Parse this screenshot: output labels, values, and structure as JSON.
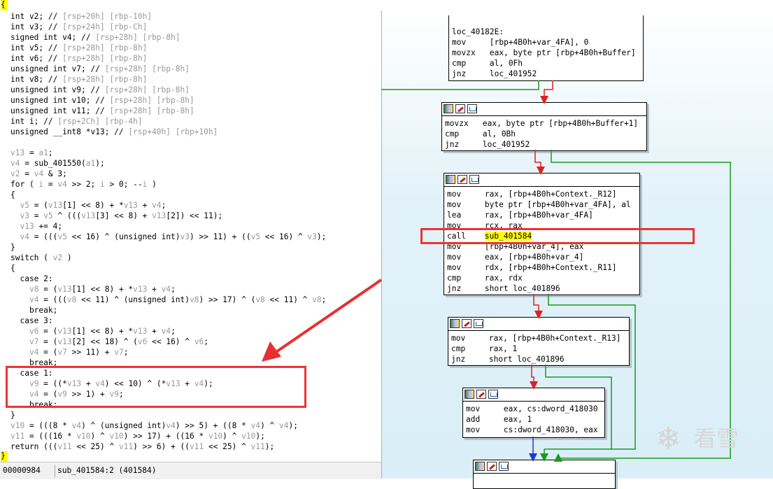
{
  "code": {
    "top_brace": "{",
    "bottom_brace": "}",
    "lines": [
      [
        [
          "int v2; // ",
          ""
        ],
        [
          "[rsp+20h] [rbp-10h]",
          "cm"
        ]
      ],
      [
        [
          "int v3; // ",
          ""
        ],
        [
          "[rsp+24h] [rbp-Ch]",
          "cm"
        ]
      ],
      [
        [
          "signed int v4; // ",
          ""
        ],
        [
          "[rsp+28h] [rbp-8h]",
          "cm"
        ]
      ],
      [
        [
          "int v5; // ",
          ""
        ],
        [
          "[rsp+28h] [rbp-8h]",
          "cm"
        ]
      ],
      [
        [
          "int v6; // ",
          ""
        ],
        [
          "[rsp+28h] [rbp-8h]",
          "cm"
        ]
      ],
      [
        [
          "unsigned int v7; // ",
          ""
        ],
        [
          "[rsp+28h] [rbp-8h]",
          "cm"
        ]
      ],
      [
        [
          "int v8; // ",
          ""
        ],
        [
          "[rsp+28h] [rbp-8h]",
          "cm"
        ]
      ],
      [
        [
          "unsigned int v9; // ",
          ""
        ],
        [
          "[rsp+28h] [rbp-8h]",
          "cm"
        ]
      ],
      [
        [
          "unsigned int v10; // ",
          ""
        ],
        [
          "[rsp+28h] [rbp-8h]",
          "cm"
        ]
      ],
      [
        [
          "unsigned int v11; // ",
          ""
        ],
        [
          "[rsp+28h] [rbp-8h]",
          "cm"
        ]
      ],
      [
        [
          "int i; // ",
          ""
        ],
        [
          "[rsp+2Ch] [rbp-4h]",
          "cm"
        ]
      ],
      [
        [
          "unsigned __int8 *v13; // ",
          ""
        ],
        [
          "[rsp+40h] [rbp+10h]",
          "cm"
        ]
      ],
      [
        [
          "",
          ""
        ]
      ],
      [
        [
          "v13",
          "cm"
        ],
        [
          " = ",
          ""
        ],
        [
          "a1",
          "cm"
        ],
        [
          ";",
          ""
        ]
      ],
      [
        [
          "v4",
          "cm"
        ],
        [
          " = sub_401550(",
          ""
        ],
        [
          "a1",
          "cm"
        ],
        [
          ");",
          ""
        ]
      ],
      [
        [
          "v2",
          "cm"
        ],
        [
          " = ",
          ""
        ],
        [
          "v4",
          "cm"
        ],
        [
          " & 3;",
          ""
        ]
      ],
      [
        [
          "for ( ",
          ""
        ],
        [
          "i",
          "cm"
        ],
        [
          " = ",
          ""
        ],
        [
          "v4",
          "cm"
        ],
        [
          " >> 2; ",
          ""
        ],
        [
          "i",
          "cm"
        ],
        [
          " > 0; --",
          ""
        ],
        [
          "i",
          "cm"
        ],
        [
          " )",
          ""
        ]
      ],
      [
        [
          "{",
          ""
        ]
      ],
      [
        [
          "  ",
          ""
        ],
        [
          "v5",
          "cm"
        ],
        [
          " = (",
          ""
        ],
        [
          "v13",
          "cm"
        ],
        [
          "[1] << 8) + *",
          ""
        ],
        [
          "v13",
          "cm"
        ],
        [
          " + ",
          ""
        ],
        [
          "v4",
          "cm"
        ],
        [
          ";",
          ""
        ]
      ],
      [
        [
          "  ",
          ""
        ],
        [
          "v3",
          "cm"
        ],
        [
          " = ",
          ""
        ],
        [
          "v5",
          "cm"
        ],
        [
          " ^ (((",
          ""
        ],
        [
          "v13",
          "cm"
        ],
        [
          "[3] << 8) + ",
          ""
        ],
        [
          "v13",
          "cm"
        ],
        [
          "[2]) << 11);",
          ""
        ]
      ],
      [
        [
          "  ",
          ""
        ],
        [
          "v13",
          "cm"
        ],
        [
          " += 4;",
          ""
        ]
      ],
      [
        [
          "  ",
          ""
        ],
        [
          "v4",
          "cm"
        ],
        [
          " = (((",
          ""
        ],
        [
          "v5",
          "cm"
        ],
        [
          " << 16) ^ (unsigned int)",
          ""
        ],
        [
          "v3",
          "cm"
        ],
        [
          ") >> 11) + ((",
          ""
        ],
        [
          "v5",
          "cm"
        ],
        [
          " << 16) ^ ",
          ""
        ],
        [
          "v3",
          "cm"
        ],
        [
          ");",
          ""
        ]
      ],
      [
        [
          "}",
          ""
        ]
      ],
      [
        [
          "switch ( ",
          ""
        ],
        [
          "v2",
          "cm"
        ],
        [
          " )",
          ""
        ]
      ],
      [
        [
          "{",
          ""
        ]
      ],
      [
        [
          "  case 2:",
          ""
        ]
      ],
      [
        [
          "    ",
          ""
        ],
        [
          "v8",
          "cm"
        ],
        [
          " = (",
          ""
        ],
        [
          "v13",
          "cm"
        ],
        [
          "[1] << 8) + *",
          ""
        ],
        [
          "v13",
          "cm"
        ],
        [
          " + ",
          ""
        ],
        [
          "v4",
          "cm"
        ],
        [
          ";",
          ""
        ]
      ],
      [
        [
          "    ",
          ""
        ],
        [
          "v4",
          "cm"
        ],
        [
          " = (((",
          ""
        ],
        [
          "v8",
          "cm"
        ],
        [
          " << 11) ^ (unsigned int)",
          ""
        ],
        [
          "v8",
          "cm"
        ],
        [
          ") >> 17) ^ (",
          ""
        ],
        [
          "v8",
          "cm"
        ],
        [
          " << 11) ^ ",
          ""
        ],
        [
          "v8",
          "cm"
        ],
        [
          ";",
          ""
        ]
      ],
      [
        [
          "    break;",
          ""
        ]
      ],
      [
        [
          "  case 3:",
          ""
        ]
      ],
      [
        [
          "    ",
          ""
        ],
        [
          "v6",
          "cm"
        ],
        [
          " = (",
          ""
        ],
        [
          "v13",
          "cm"
        ],
        [
          "[1] << 8) + *",
          ""
        ],
        [
          "v13",
          "cm"
        ],
        [
          " + ",
          ""
        ],
        [
          "v4",
          "cm"
        ],
        [
          ";",
          ""
        ]
      ],
      [
        [
          "    ",
          ""
        ],
        [
          "v7",
          "cm"
        ],
        [
          " = (",
          ""
        ],
        [
          "v13",
          "cm"
        ],
        [
          "[2] << 18) ^ (",
          ""
        ],
        [
          "v6",
          "cm"
        ],
        [
          " << 16) ^ ",
          ""
        ],
        [
          "v6",
          "cm"
        ],
        [
          ";",
          ""
        ]
      ],
      [
        [
          "    ",
          ""
        ],
        [
          "v4",
          "cm"
        ],
        [
          " = (",
          ""
        ],
        [
          "v7",
          "cm"
        ],
        [
          " >> 11) + ",
          ""
        ],
        [
          "v7",
          "cm"
        ],
        [
          ";",
          ""
        ]
      ],
      [
        [
          "    break;",
          ""
        ]
      ],
      [
        [
          "  case 1:",
          ""
        ]
      ],
      [
        [
          "    ",
          ""
        ],
        [
          "v9",
          "cm"
        ],
        [
          " = ((*",
          ""
        ],
        [
          "v13",
          "cm"
        ],
        [
          " + ",
          ""
        ],
        [
          "v4",
          "cm"
        ],
        [
          ") << 10) ^ (*",
          ""
        ],
        [
          "v13",
          "cm"
        ],
        [
          " + ",
          ""
        ],
        [
          "v4",
          "cm"
        ],
        [
          ");",
          ""
        ]
      ],
      [
        [
          "    ",
          ""
        ],
        [
          "v4",
          "cm"
        ],
        [
          " = (",
          ""
        ],
        [
          "v9",
          "cm"
        ],
        [
          " >> 1) + ",
          ""
        ],
        [
          "v9",
          "cm"
        ],
        [
          ";",
          ""
        ]
      ],
      [
        [
          "    break;",
          ""
        ]
      ],
      [
        [
          "}",
          ""
        ]
      ],
      [
        [
          "v10",
          "cm"
        ],
        [
          " = (((8 * ",
          ""
        ],
        [
          "v4",
          "cm"
        ],
        [
          ") ^ (unsigned int)",
          ""
        ],
        [
          "v4",
          "cm"
        ],
        [
          ") >> 5) + ((8 * ",
          ""
        ],
        [
          "v4",
          "cm"
        ],
        [
          ") ^ ",
          ""
        ],
        [
          "v4",
          "cm"
        ],
        [
          ");",
          ""
        ]
      ],
      [
        [
          "v11",
          "cm"
        ],
        [
          " = (((16 * ",
          ""
        ],
        [
          "v10",
          "cm"
        ],
        [
          ") ^ ",
          ""
        ],
        [
          "v10",
          "cm"
        ],
        [
          ") >> 17) + ((16 * ",
          ""
        ],
        [
          "v10",
          "cm"
        ],
        [
          ") ^ ",
          ""
        ],
        [
          "v10",
          "cm"
        ],
        [
          ");",
          ""
        ]
      ],
      [
        [
          "return (((",
          ""
        ],
        [
          "v11",
          "cm"
        ],
        [
          " << 25) ^ ",
          ""
        ],
        [
          "v11",
          "cm"
        ],
        [
          ") >> 6) + ((",
          ""
        ],
        [
          "v11",
          "cm"
        ],
        [
          " << 25) ^ ",
          ""
        ],
        [
          "v11",
          "cm"
        ],
        [
          ");",
          ""
        ]
      ]
    ]
  },
  "status": {
    "offset": "00000984",
    "location": "sub_401584:2 (401584)"
  },
  "graph": {
    "blocks": [
      {
        "lines": [
          [
            "loc_40182E:",
            ""
          ],
          [
            "mov     [rbp+4B0h+var_4FA], 0",
            ""
          ],
          [
            "movzx   eax, byte ptr [rbp+4B0h+Buffer]",
            ""
          ],
          [
            "cmp     al, 0Fh",
            ""
          ],
          [
            "jnz     loc_401952",
            ""
          ]
        ]
      },
      {
        "lines": [
          [
            "movzx   eax, byte ptr [rbp+4B0h+Buffer+1]",
            ""
          ],
          [
            "cmp     al, 0Bh",
            ""
          ],
          [
            "jnz     loc_401952",
            ""
          ]
        ]
      },
      {
        "lines": [
          [
            "mov     rax, [rbp+4B0h+Context._R12]",
            ""
          ],
          [
            "mov     byte ptr [rbp+4B0h+var_4FA], al",
            ""
          ],
          [
            "lea     rax, [rbp+4B0h+var_4FA]",
            ""
          ],
          [
            "mov     rcx, rax",
            ""
          ],
          [
            "call    ",
            "sub_401584"
          ],
          [
            "mov     [rbp+4B0h+var_4], eax",
            ""
          ],
          [
            "mov     eax, [rbp+4B0h+var_4]",
            ""
          ],
          [
            "mov     rdx, [rbp+4B0h+Context._R11]",
            ""
          ],
          [
            "cmp     rax, rdx",
            ""
          ],
          [
            "jnz     short loc_401896",
            ""
          ]
        ]
      },
      {
        "lines": [
          [
            "mov     rax, [rbp+4B0h+Context._R13]",
            ""
          ],
          [
            "cmp     rax, 1",
            ""
          ],
          [
            "jnz     short loc_401896",
            ""
          ]
        ]
      },
      {
        "lines": [
          [
            "mov     eax, cs:dword_418030",
            ""
          ],
          [
            "add     eax, 1",
            ""
          ],
          [
            "mov     cs:dword_418030, eax",
            ""
          ]
        ]
      },
      {
        "lines": []
      }
    ]
  },
  "watermark": {
    "logo": "❄",
    "text": "看雪"
  },
  "colors": {
    "highlight": "#ffff00",
    "annotation": "#e83030",
    "edge_red": "#e02020",
    "edge_green": "#1a9a1a",
    "edge_blue": "#1a3ad0"
  }
}
